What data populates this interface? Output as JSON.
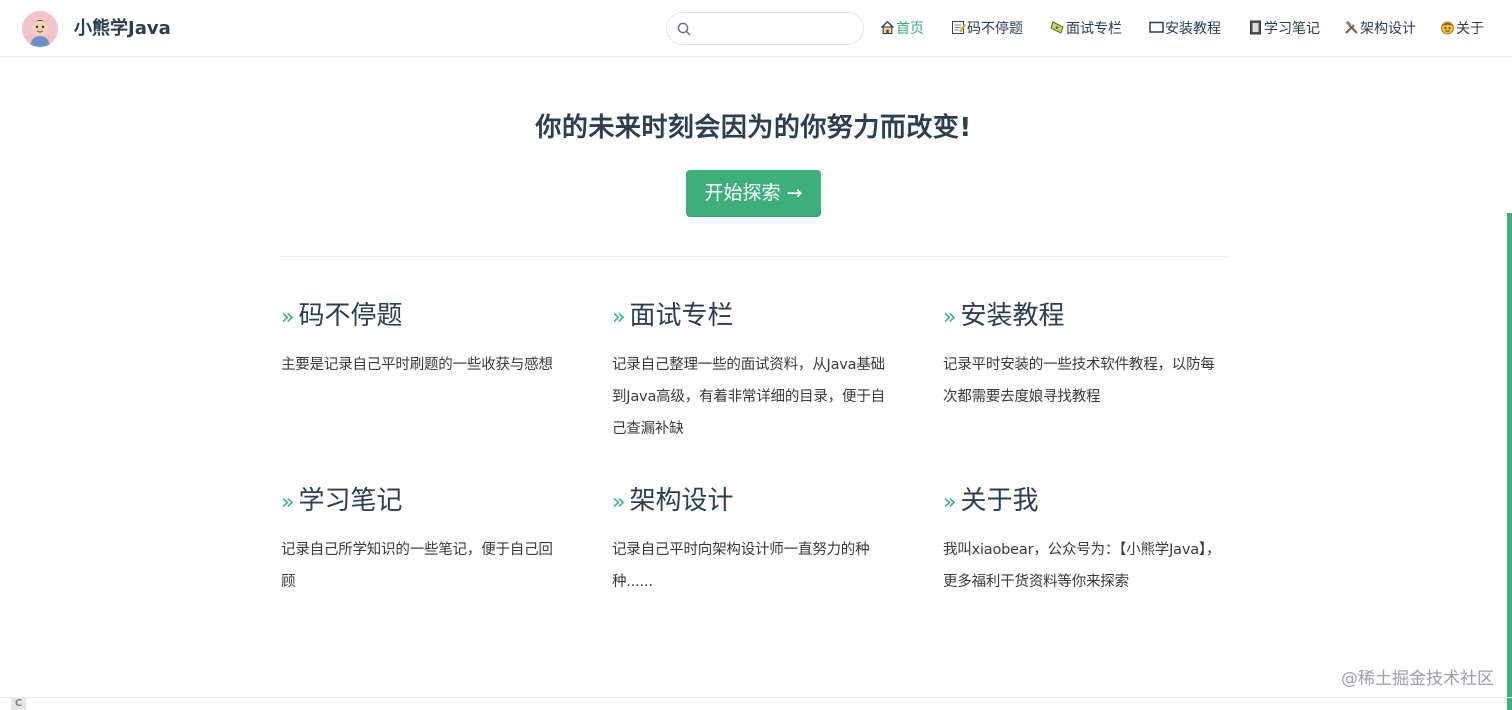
{
  "header": {
    "site_name": "小熊学Java",
    "search": {
      "value": "",
      "placeholder": ""
    },
    "nav": [
      {
        "label": "首页",
        "icon": "home-icon",
        "active": true
      },
      {
        "label": "码不停题",
        "icon": "memo-icon",
        "active": false
      },
      {
        "label": "面试专栏",
        "icon": "ticket-icon",
        "active": false
      },
      {
        "label": "安装教程",
        "icon": "monitor-icon",
        "active": false
      },
      {
        "label": "学习笔记",
        "icon": "notebook-icon",
        "active": false
      },
      {
        "label": "架构设计",
        "icon": "tools-icon",
        "active": false
      },
      {
        "label": "关于",
        "icon": "face-icon",
        "active": false
      }
    ]
  },
  "hero": {
    "tagline": "你的未来时刻会因为的你努力而改变!",
    "action": "开始探索 →"
  },
  "features": [
    {
      "title": "码不停题",
      "details": "主要是记录自己平时刷题的一些收获与感想"
    },
    {
      "title": "面试专栏",
      "details": "记录自己整理一些的面试资料，从Java基础到Java高级，有着非常详细的目录，便于自己查漏补缺"
    },
    {
      "title": "安装教程",
      "details": "记录平时安装的一些技术软件教程，以防每次都需要去度娘寻找教程"
    },
    {
      "title": "学习笔记",
      "details": "记录自己所学知识的一些笔记，便于自己回顾"
    },
    {
      "title": "架构设计",
      "details": "记录自己平时向架构设计师一直努力的种种......"
    },
    {
      "title": "关于我",
      "details": "我叫xiaobear，公众号为：【小熊学Java】，更多福利干货资料等你来探索"
    }
  ],
  "feature_marker": "»",
  "watermark": "@稀土掘金技术社区",
  "corner_badge": "C",
  "colors": {
    "accent": "#3eaf7c",
    "text": "#2c3e50",
    "border": "#eaecef"
  }
}
